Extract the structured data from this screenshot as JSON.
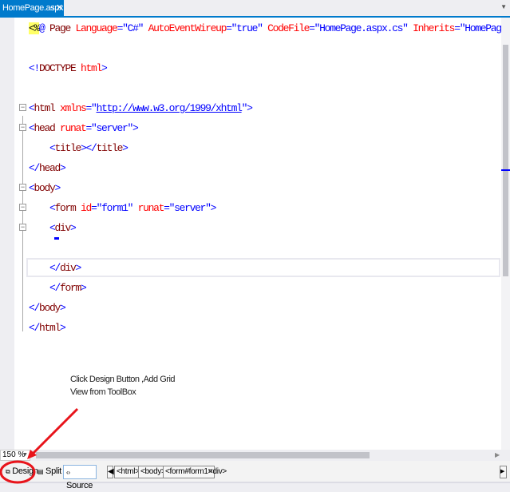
{
  "tab": {
    "title": "HomePage.aspx",
    "pin_icon": "pin-icon",
    "close_icon": "close-icon"
  },
  "code_lines": [
    [
      [
        "h",
        "<%"
      ],
      [
        "b",
        "@ "
      ],
      [
        "n",
        "Page "
      ],
      [
        "a",
        "Language"
      ],
      [
        "b",
        "=\"C#\" "
      ],
      [
        "a",
        "AutoEventWireup"
      ],
      [
        "b",
        "=\"true\" "
      ],
      [
        "a",
        "CodeFile"
      ],
      [
        "b",
        "=\"HomePage.aspx.cs\" "
      ],
      [
        "a",
        "Inherits"
      ],
      [
        "b",
        "=\"HomePage"
      ]
    ],
    [],
    [
      [
        "b",
        "<!"
      ],
      [
        "n",
        "DOCTYPE "
      ],
      [
        "a",
        "html"
      ],
      [
        "b",
        ">"
      ]
    ],
    [],
    [
      [
        "b",
        "<"
      ],
      [
        "n",
        "html "
      ],
      [
        "a",
        "xmlns"
      ],
      [
        "b",
        "=\""
      ],
      [
        "u",
        "http://www.w3.org/1999/xhtml"
      ],
      [
        "b",
        "\">"
      ]
    ],
    [
      [
        "b",
        "<"
      ],
      [
        "n",
        "head "
      ],
      [
        "a",
        "runat"
      ],
      [
        "b",
        "=\"server\">"
      ]
    ],
    [
      [
        "p",
        "    "
      ],
      [
        "b",
        "<"
      ],
      [
        "n",
        "title"
      ],
      [
        "b",
        "></"
      ],
      [
        "n",
        "title"
      ],
      [
        "b",
        ">"
      ]
    ],
    [
      [
        "b",
        "</"
      ],
      [
        "n",
        "head"
      ],
      [
        "b",
        ">"
      ]
    ],
    [
      [
        "b",
        "<"
      ],
      [
        "n",
        "body"
      ],
      [
        "b",
        ">"
      ]
    ],
    [
      [
        "p",
        "    "
      ],
      [
        "b",
        "<"
      ],
      [
        "n",
        "form "
      ],
      [
        "a",
        "id"
      ],
      [
        "b",
        "=\"form1\" "
      ],
      [
        "a",
        "runat"
      ],
      [
        "b",
        "=\"server\">"
      ]
    ],
    [
      [
        "p",
        "    "
      ],
      [
        "b",
        "<"
      ],
      [
        "n",
        "div"
      ],
      [
        "b",
        ">"
      ]
    ],
    [],
    [
      [
        "p",
        "    "
      ],
      [
        "b",
        "</"
      ],
      [
        "n",
        "div"
      ],
      [
        "b",
        ">"
      ]
    ],
    [
      [
        "p",
        "    "
      ],
      [
        "b",
        "</"
      ],
      [
        "n",
        "form"
      ],
      [
        "b",
        ">"
      ]
    ],
    [
      [
        "b",
        "</"
      ],
      [
        "n",
        "body"
      ],
      [
        "b",
        ">"
      ]
    ],
    [
      [
        "b",
        "</"
      ],
      [
        "n",
        "html"
      ],
      [
        "b",
        ">"
      ]
    ]
  ],
  "annotation": {
    "line1": "Click Design Button ,Add Grid",
    "line2": "View from ToolBox",
    "color": "#e8141b"
  },
  "zoom_level": "150 %",
  "view_buttons": {
    "design": "Design",
    "split": "Split",
    "source": "Source"
  },
  "breadcrumbs": [
    "<html>",
    "<body>",
    "<form#form1>",
    "<div>"
  ]
}
